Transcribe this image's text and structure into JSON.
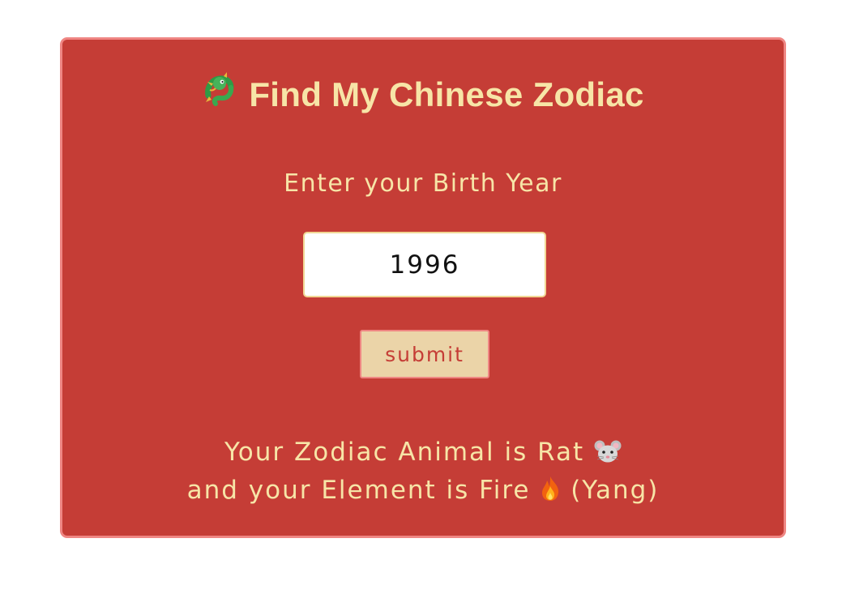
{
  "header": {
    "icon": "dragon-icon",
    "title": "Find My Chinese Zodiac"
  },
  "form": {
    "label": "Enter your Birth Year",
    "year_value": "1996",
    "submit_label": "submit"
  },
  "result": {
    "line1_text": "Your Zodiac Animal is Rat",
    "line1_icon": "rat-icon",
    "line2_text": "and your Element is Fire",
    "line2_icon": "fire-icon",
    "line2_suffix": "(Yang)"
  },
  "colors": {
    "card_background": "#c53d36",
    "card_border": "#ef8683",
    "text_accent": "#f7e5a7",
    "button_background": "#ebd4a8",
    "button_text": "#c53d36"
  }
}
